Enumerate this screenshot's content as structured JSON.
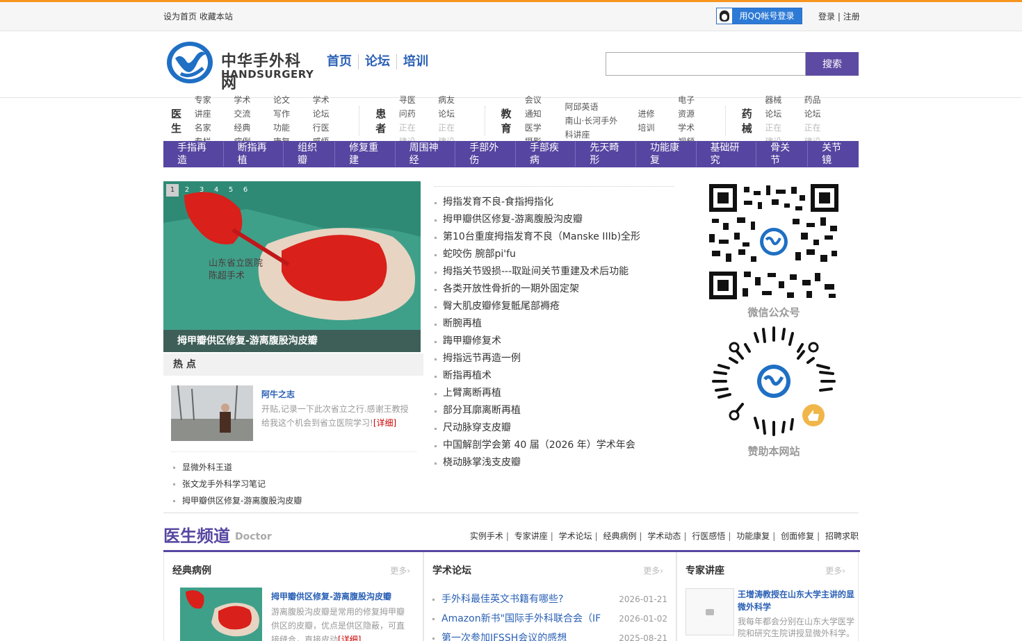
{
  "topbar": {
    "left": "设为首页 收藏本站",
    "qq_login": "用QQ帐号登录",
    "login": "登录",
    "register": "注册"
  },
  "header": {
    "logo_cn": "中华手外科网",
    "logo_en": "HANDSURGERY",
    "nav": [
      "首页",
      "论坛",
      "培训"
    ],
    "search_placeholder": "",
    "search_button": "搜索"
  },
  "categories": [
    {
      "title": "医生",
      "cols": [
        [
          "专家讲座",
          "名家专栏"
        ],
        [
          "学术交流",
          "经典病例"
        ],
        [
          "论文写作",
          "功能康复"
        ],
        [
          "学术论坛",
          "行医感悟"
        ]
      ]
    },
    {
      "title": "患者",
      "cols": [
        [
          "寻医问药",
          "正在建设"
        ],
        [
          "病友论坛",
          "正在建设"
        ]
      ]
    },
    {
      "title": "教育",
      "cols": [
        [
          "会议通知",
          "医学摄影"
        ],
        [
          "阿邱英语",
          "南山·长河手外科讲座"
        ],
        [
          "进修培训",
          ""
        ],
        [
          "电子资源",
          "学术视频"
        ]
      ]
    },
    {
      "title": "药械",
      "cols": [
        [
          "器械论坛",
          "正在建设"
        ],
        [
          "药品论坛",
          "正在建设"
        ]
      ]
    }
  ],
  "purple_nav": [
    "手指再造",
    "断指再植",
    "组织瓣",
    "修复重建",
    "周围神经",
    "手部外伤",
    "手部疾病",
    "先天畸形",
    "功能康复",
    "基础研究",
    "骨关节",
    "关节镜"
  ],
  "slider": {
    "dots": [
      "1",
      "2",
      "3",
      "4",
      "5",
      "6"
    ],
    "active_dot": 1,
    "watermark": "山东省立医院 陈超手术",
    "caption": "拇甲瓣供区修复-游离腹股沟皮瓣"
  },
  "hot": {
    "title": "热 点",
    "feature_title": "阿牛之志",
    "feature_desc": "开贴,记录一下此次省立之行.感谢王教授给我这个机会到省立医院学习!",
    "feature_more": "[详细]",
    "items": [
      "显微外科王道",
      "张文龙手外科学习笔记",
      "拇甲瓣供区修复-游离腹股沟皮瓣"
    ]
  },
  "news": [
    "拇指发育不良-食指拇指化",
    "拇甲瓣供区修复-游离腹股沟皮瓣",
    "第10台重度拇指发育不良（Manske IIIb)全形",
    "蛇咬伤 腕部pi'fu",
    "拇指关节毁损---取趾间关节重建及术后功能",
    "各类开放性骨折的一期外固定架",
    "臀大肌皮瓣修复骶尾部褥疮",
    "断腕再植",
    "踇甲瓣修复术",
    "拇指远节再造一例",
    "断指再植术",
    "上臂离断再植",
    "部分耳廓离断再植",
    "尺动脉穿支皮瓣",
    "中国解剖学会第 40 届（2026 年）学术年会",
    "桡动脉掌浅支皮瓣"
  ],
  "qr": {
    "wechat_label": "微信公众号",
    "donate_label": "赞助本网站"
  },
  "doctor": {
    "title": "医生频道",
    "title_en": "Doctor",
    "links": [
      "实例手术",
      "专家讲座",
      "学术论坛",
      "经典病例",
      "学术动态",
      "行医感悟",
      "功能康复",
      "创面修复",
      "招聘求职"
    ]
  },
  "boxes": {
    "classic": {
      "title": "经典病例",
      "more": "更多›",
      "item_title": "拇甲瓣供区修复-游离腹股沟皮瓣",
      "item_desc": "游离腹股沟皮瓣是常用的修复拇甲瓣供区的皮瓣，优点是供区隐蔽，可直接缝合，直接皮动",
      "item_more": "[详细]"
    },
    "forum": {
      "title": "学术论坛",
      "more": "更多›",
      "items": [
        {
          "title": "手外科最佳英文书籍有哪些?",
          "date": "2026-01-21"
        },
        {
          "title": "Amazon新书\"国际手外科联合会（IF",
          "date": "2026-01-02"
        },
        {
          "title": "第一次参加IFSSH会议的感想",
          "date": "2025-08-21"
        }
      ]
    },
    "lecture": {
      "title": "专家讲座",
      "more": "更多›",
      "item_title": "王增涛教授在山东大学主讲的显微外科学",
      "item_desc": "我每年都会分别在山东大学医学院和研究生院讲授显微外科学。"
    }
  },
  "colors": {
    "accent_orange": "#f7941d",
    "brand_purple": "#5646a1",
    "link_blue": "#2a60b5"
  }
}
